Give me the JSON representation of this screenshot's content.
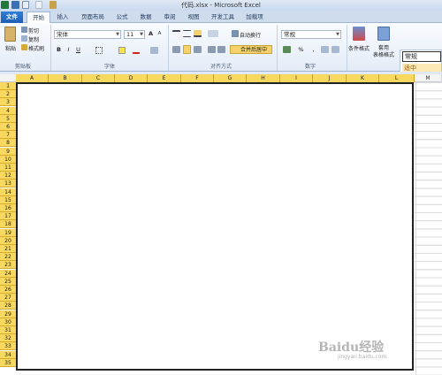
{
  "window": {
    "title": "代码.xlsx - Microsoft Excel"
  },
  "tabs": [
    "文件",
    "开始",
    "插入",
    "页面布局",
    "公式",
    "数据",
    "审阅",
    "视图",
    "开发工具",
    "加载项"
  ],
  "clipboard": {
    "paste": "粘贴",
    "cut": "剪切",
    "copy": "复制",
    "painter": "格式刷",
    "label": "剪贴板"
  },
  "font": {
    "name": "宋体",
    "size": "11",
    "label": "字体",
    "bold": "B",
    "italic": "I",
    "underline": "U"
  },
  "alignment": {
    "wrap": "自动换行",
    "merge": "合并后居中",
    "label": "对齐方式"
  },
  "number": {
    "format": "常规",
    "percent": "%",
    "comma": ",",
    "label": "数字"
  },
  "styles": {
    "conditional": "条件格式",
    "table": "套用",
    "table2": "表格格式",
    "normal": "常规",
    "medium": "适中"
  },
  "columns": [
    "A",
    "B",
    "C",
    "D",
    "E",
    "F",
    "G",
    "H",
    "I",
    "J",
    "K",
    "L",
    "M"
  ],
  "rows": [
    "1",
    "2",
    "3",
    "4",
    "5",
    "6",
    "7",
    "8",
    "9",
    "10",
    "11",
    "12",
    "13",
    "14",
    "15",
    "16",
    "17",
    "18",
    "19",
    "20",
    "21",
    "22",
    "23",
    "24",
    "25",
    "26",
    "27",
    "28",
    "29",
    "30",
    "31",
    "32",
    "33",
    "34",
    "35"
  ],
  "watermark": {
    "brand": "Baidu经验",
    "sub": "jingyan.baidu.com"
  }
}
